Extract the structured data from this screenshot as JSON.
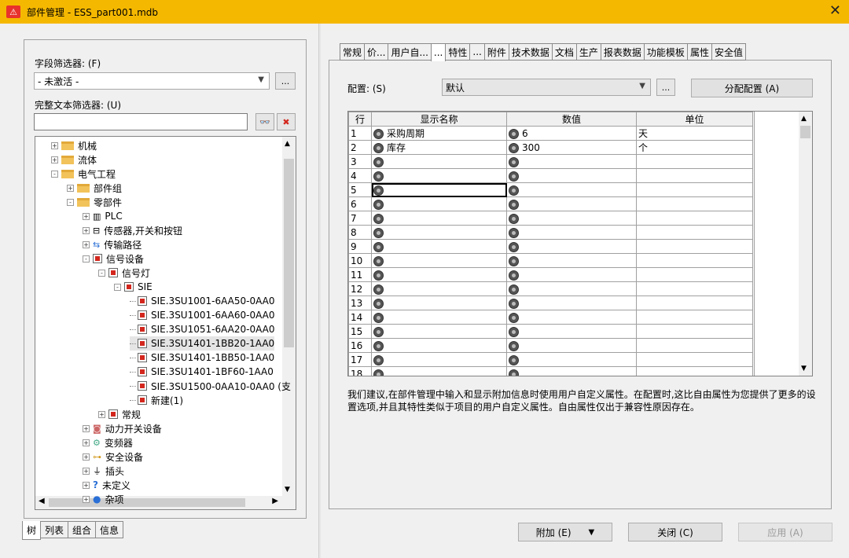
{
  "window": {
    "title": "部件管理 - ESS_part001.mdb",
    "close": "✕"
  },
  "left": {
    "field_filter_label": "字段筛选器: (F)",
    "field_filter_value": "- 未激活 -",
    "text_filter_label": "完整文本筛选器: (U)",
    "text_filter_value": "",
    "ellipsis": "...",
    "tree": [
      {
        "text": "机械",
        "icon": "folder-icon",
        "exp": "+"
      },
      {
        "text": "流体",
        "icon": "folder-icon",
        "exp": "+"
      },
      {
        "text": "电气工程",
        "icon": "folder-icon",
        "exp": "-"
      },
      {
        "text": "部件组",
        "icon": "folder-icon",
        "exp": "+"
      },
      {
        "text": "零部件",
        "icon": "folder-icon",
        "exp": "-"
      },
      {
        "text": "PLC",
        "icon": "plc-icon",
        "exp": "+"
      },
      {
        "text": "传感器,开关和按钮",
        "icon": "sensor-icon",
        "exp": "+"
      },
      {
        "text": "传输路径",
        "icon": "transmission-icon",
        "exp": "+"
      },
      {
        "text": "信号设备",
        "icon": "signal-device-icon",
        "exp": "-"
      },
      {
        "text": "信号灯",
        "icon": "signal-lamp-icon",
        "exp": "-"
      },
      {
        "text": "SIE",
        "icon": "signal-lamp-icon",
        "exp": "-"
      },
      {
        "text": "SIE.3SU1001-6AA50-0AA0",
        "icon": "part-icon",
        "exp": ""
      },
      {
        "text": "SIE.3SU1001-6AA60-0AA0",
        "icon": "part-icon",
        "exp": ""
      },
      {
        "text": "SIE.3SU1051-6AA20-0AA0",
        "icon": "part-icon",
        "exp": ""
      },
      {
        "text": "SIE.3SU1401-1BB20-1AA0",
        "icon": "part-icon",
        "exp": ""
      },
      {
        "text": "SIE.3SU1401-1BB50-1AA0",
        "icon": "part-icon",
        "exp": ""
      },
      {
        "text": "SIE.3SU1401-1BF60-1AA0",
        "icon": "part-icon",
        "exp": ""
      },
      {
        "text": "SIE.3SU1500-0AA10-0AA0 (支",
        "icon": "part-icon",
        "exp": ""
      },
      {
        "text": "新建(1)",
        "icon": "part-icon",
        "exp": ""
      },
      {
        "text": "常规",
        "icon": "signal-device-icon",
        "exp": "+"
      },
      {
        "text": "动力开关设备",
        "icon": "power-switch-icon",
        "exp": "+"
      },
      {
        "text": "变频器",
        "icon": "inverter-icon",
        "exp": "+"
      },
      {
        "text": "安全设备",
        "icon": "safety-icon",
        "exp": "+"
      },
      {
        "text": "插头",
        "icon": "plug-icon",
        "exp": "+"
      },
      {
        "text": "未定义",
        "icon": "question-icon",
        "exp": "+"
      },
      {
        "text": "杂项",
        "icon": "misc-icon",
        "exp": "+"
      }
    ],
    "bottom_tabs": [
      "树",
      "列表",
      "组合",
      "信息"
    ]
  },
  "right": {
    "tabs": [
      "常规",
      "价...",
      "用户自...",
      "...",
      "特性",
      "...",
      "附件",
      "技术数据",
      "文档",
      "生产",
      "报表数据",
      "功能模板",
      "属性",
      "安全值"
    ],
    "config_label": "配置: (S)",
    "config_value": "默认",
    "assign_button": "分配配置 (A)",
    "grid_headers": [
      "行",
      "显示名称",
      "数值",
      "单位"
    ],
    "rows": [
      {
        "n": "1",
        "name": "采购周期",
        "value": "6",
        "unit": "天"
      },
      {
        "n": "2",
        "name": "库存",
        "value": "300",
        "unit": "个"
      },
      {
        "n": "3",
        "name": "",
        "value": "",
        "unit": ""
      },
      {
        "n": "4",
        "name": "",
        "value": "",
        "unit": ""
      },
      {
        "n": "5",
        "name": "",
        "value": "",
        "unit": ""
      },
      {
        "n": "6",
        "name": "",
        "value": "",
        "unit": ""
      },
      {
        "n": "7",
        "name": "",
        "value": "",
        "unit": ""
      },
      {
        "n": "8",
        "name": "",
        "value": "",
        "unit": ""
      },
      {
        "n": "9",
        "name": "",
        "value": "",
        "unit": ""
      },
      {
        "n": "10",
        "name": "",
        "value": "",
        "unit": ""
      },
      {
        "n": "11",
        "name": "",
        "value": "",
        "unit": ""
      },
      {
        "n": "12",
        "name": "",
        "value": "",
        "unit": ""
      },
      {
        "n": "13",
        "name": "",
        "value": "",
        "unit": ""
      },
      {
        "n": "14",
        "name": "",
        "value": "",
        "unit": ""
      },
      {
        "n": "15",
        "name": "",
        "value": "",
        "unit": ""
      },
      {
        "n": "16",
        "name": "",
        "value": "",
        "unit": ""
      },
      {
        "n": "17",
        "name": "",
        "value": "",
        "unit": ""
      },
      {
        "n": "18",
        "name": "",
        "value": "",
        "unit": ""
      }
    ],
    "info_text": "我们建议,在部件管理中输入和显示附加信息时使用用户自定义属性。在配置时,这比自由属性为您提供了更多的设置选项,并且其特性类似于项目的用户自定义属性。自由属性仅出于兼容性原因存在。"
  },
  "buttons": {
    "add": "附加 (E)",
    "close": "关闭 (C)",
    "apply": "应用 (A)"
  }
}
